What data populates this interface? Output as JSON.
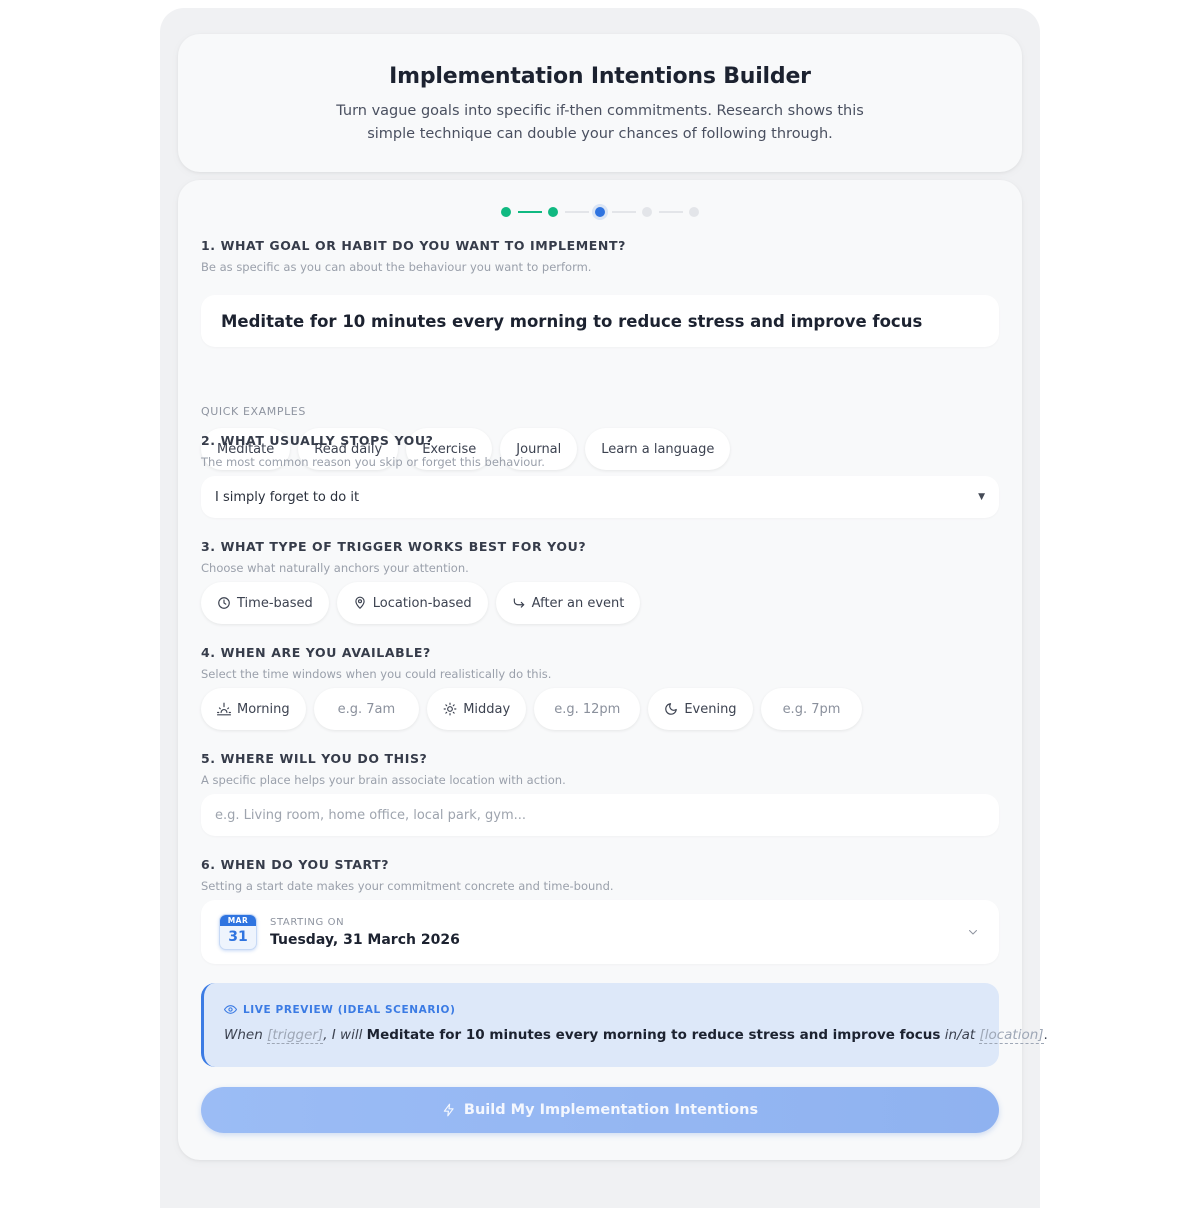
{
  "header": {
    "title": "Implementation Intentions Builder",
    "subtitle": "Turn vague goals into specific if-then commitments. Research shows this simple technique can double your chances of following through."
  },
  "stepper": {
    "total": 5,
    "current": 3,
    "colors": {
      "done": "#10b981",
      "current": "#2f74e0",
      "pending": "#e3e5e9"
    }
  },
  "q1": {
    "title": "1. What goal or habit do you want to implement?",
    "subtitle": "Be as specific as you can about the behaviour you want to perform.",
    "value": "Meditate for 10 minutes every morning to reduce stress and improve focus",
    "examples_label": "QUICK EXAMPLES",
    "examples": [
      "Meditate",
      "Read daily",
      "Exercise",
      "Journal",
      "Learn a language"
    ]
  },
  "q2": {
    "title": "2. What usually stops you?",
    "subtitle": "The most common reason you skip or forget this behaviour.",
    "selected": "I simply forget to do it"
  },
  "q3": {
    "title": "3. What type of trigger works best for you?",
    "subtitle": "Choose what naturally anchors your attention.",
    "options": [
      {
        "label": "Time-based",
        "icon": "clock-icon"
      },
      {
        "label": "Location-based",
        "icon": "map-pin-icon"
      },
      {
        "label": "After an event",
        "icon": "corner-arrow-icon"
      }
    ]
  },
  "q4": {
    "title": "4. When are you available?",
    "subtitle": "Select the time windows when you could realistically do this.",
    "windows": [
      {
        "label": "Morning",
        "icon": "sunrise-icon",
        "placeholder": "e.g. 7am"
      },
      {
        "label": "Midday",
        "icon": "sun-icon",
        "placeholder": "e.g. 12pm"
      },
      {
        "label": "Evening",
        "icon": "moon-icon",
        "placeholder": "e.g. 7pm"
      }
    ]
  },
  "q5": {
    "title": "5. Where will you do this?",
    "subtitle": "A specific place helps your brain associate location with action.",
    "placeholder": "e.g. Living room, home office, local park, gym..."
  },
  "q6": {
    "title": "6. When do you start?",
    "subtitle": "Setting a start date makes your commitment concrete and time-bound.",
    "cal_month": "MAR",
    "cal_day": "31",
    "starting_label": "STARTING ON",
    "date": "Tuesday, 31 March 2026"
  },
  "preview": {
    "label": "LIVE PREVIEW (IDEAL SCENARIO)",
    "when": "When",
    "trigger_ph": "[trigger]",
    "i_will": ", I will",
    "goal": "Meditate for 10 minutes every morning to reduce stress and improve focus",
    "in_at": "in/at",
    "location_ph": "[location]",
    "end": "."
  },
  "build_button": "Build My Implementation Intentions"
}
